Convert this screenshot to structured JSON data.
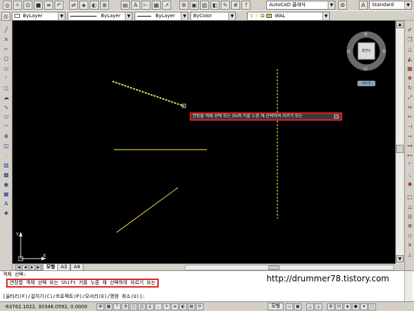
{
  "toolbar": {
    "layer_value": "ByLayer",
    "linetype_value": "ByLayer",
    "lineweight_value": "ByLayer",
    "color_value": "ByColor",
    "workspace_value": "AutoCAD 클래식",
    "style_value": "Standard",
    "current_layer": "WAL"
  },
  "viewcube": {
    "north": "북",
    "south": "남",
    "east": "동",
    "west": "서",
    "face": "평면도",
    "wcs_label": "WCS"
  },
  "tooltip": {
    "text": "연장할 객체 선택 또는 Shift 키를 누른 채 선택하여 자르기 또는"
  },
  "layout_tabs": [
    {
      "label": "모형"
    },
    {
      "label": "A3"
    },
    {
      "label": "A4"
    }
  ],
  "command": {
    "history_line": "객체 선택:",
    "prompt_line": "연장할 객체 선택 또는 Shift 키를 누른 채 선택하여 자르기 또는",
    "options_line": "[울타리(F)/걸치기(C)/프로젝트(P)/모서리(E)/명령 취소(U)]:"
  },
  "watermark": "http://drummer78.tistory.com",
  "status": {
    "coordinates": "-63762.1022, 30346.0592, 0.0000",
    "model_button": "모형"
  },
  "colors": {
    "canvas": "#000000",
    "entity": "#d8b84a",
    "selected_entity": "#e8e060",
    "highlight_frame": "#e0201c"
  }
}
